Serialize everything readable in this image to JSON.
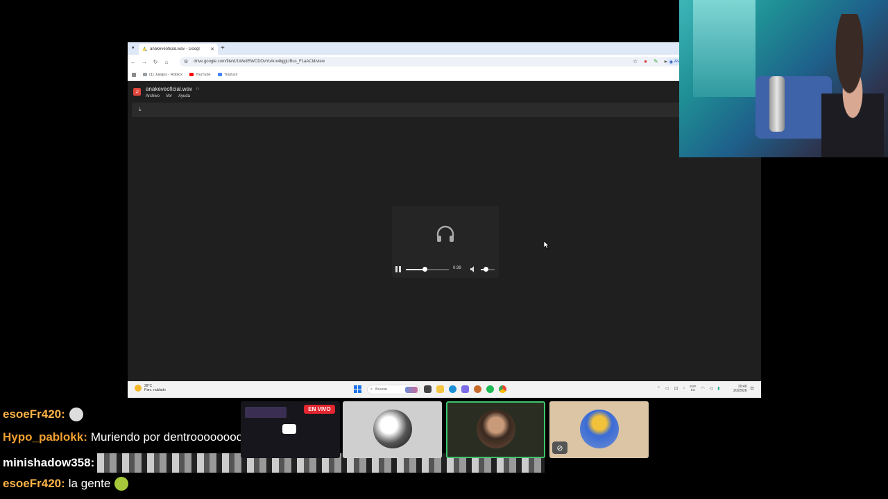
{
  "browser": {
    "tab_title": "anakeveoficial.wav - Googl",
    "tab_close": "✕",
    "new_tab": "+",
    "url": "drive.google.com/file/d/1Wedi5WCDOvYoAnx4lqjgUBus_F1aACld/view",
    "ask_google": "Ask Google",
    "bookmarks": [
      {
        "label": "(1) Juegos - Roblox",
        "color": "#9aa0a6"
      },
      {
        "label": "YouTube",
        "color": "#ff0000"
      },
      {
        "label": "Traducir",
        "color": "#4285f4"
      }
    ]
  },
  "viewer": {
    "file_name": "anakeveoficial.wav",
    "menu": [
      "Archivo",
      "Ver",
      "Ayuda"
    ],
    "player": {
      "time": "0:39",
      "progress": 0.44,
      "volume": 0.35
    }
  },
  "taskbar": {
    "weather_temp": "28°C",
    "weather_desc": "Parc. nublado",
    "search_placeholder": "Buscar",
    "lang_top": "ESP",
    "lang_bottom": "ES",
    "time": "20:49",
    "date": "2/3/2026"
  },
  "chat": [
    {
      "user": "esoeFr420:",
      "text": "",
      "color": "#ffb347"
    },
    {
      "user": "Hypo_pablokk:",
      "text": "Muriendo por dentroooooooooo",
      "color": "#f0a030"
    },
    {
      "user": "minishadow358:",
      "text": "",
      "color": "#ffffff"
    },
    {
      "user": "esoeFr420:",
      "text": "la gente",
      "color": "#ffb347"
    }
  ],
  "live_badge": "EN VIVO",
  "colors": {
    "accent_live": "#e3262f",
    "speaking_border": "#3ec46d",
    "drive_bg": "#1f1f1f"
  }
}
